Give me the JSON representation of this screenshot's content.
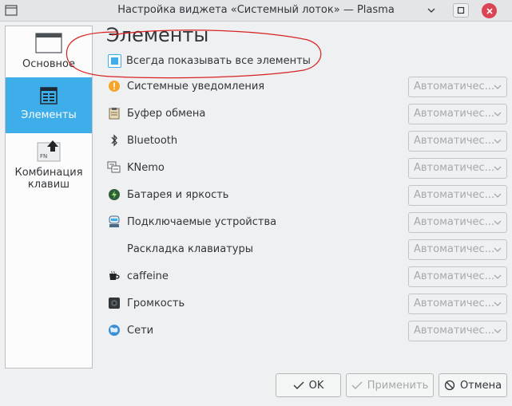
{
  "window": {
    "title": "Настройка виджета «Системный лоток» — Plasma"
  },
  "sidebar": {
    "items": [
      {
        "label": "Основное",
        "icon": "window-settings-icon",
        "selected": false
      },
      {
        "label": "Элементы",
        "icon": "list-window-icon",
        "selected": true
      },
      {
        "label": "Комбинация клавиш",
        "icon": "fn-key-icon",
        "selected": false
      }
    ]
  },
  "main": {
    "title": "Элементы",
    "show_all_label": "Всегда показывать все элементы",
    "show_all_checked": true,
    "items": [
      {
        "name": "Системные уведомления",
        "icon": "notifications-icon",
        "visibility": "Автоматичес..."
      },
      {
        "name": "Буфер обмена",
        "icon": "clipboard-icon",
        "visibility": "Автоматичес..."
      },
      {
        "name": "Bluetooth",
        "icon": "bluetooth-icon",
        "visibility": "Автоматичес..."
      },
      {
        "name": "KNemo",
        "icon": "network-monitor-icon",
        "visibility": "Автоматичес..."
      },
      {
        "name": "Батарея и яркость",
        "icon": "battery-icon",
        "visibility": "Автоматичес..."
      },
      {
        "name": "Подключаемые устройства",
        "icon": "device-icon",
        "visibility": "Автоматичес..."
      },
      {
        "name": "Раскладка клавиатуры",
        "icon": "",
        "visibility": "Автоматичес..."
      },
      {
        "name": "caffeine",
        "icon": "coffee-cup-icon",
        "visibility": "Автоматичес..."
      },
      {
        "name": "Громкость",
        "icon": "speaker-icon",
        "visibility": "Автоматичес..."
      },
      {
        "name": "Сети",
        "icon": "network-icon",
        "visibility": "Автоматичес..."
      }
    ]
  },
  "buttons": {
    "ok": "OK",
    "apply": "Применить",
    "cancel": "Отмена"
  },
  "colors": {
    "accent": "#3daee9",
    "annotation": "#d62222",
    "window_bg": "#eff0f1"
  }
}
